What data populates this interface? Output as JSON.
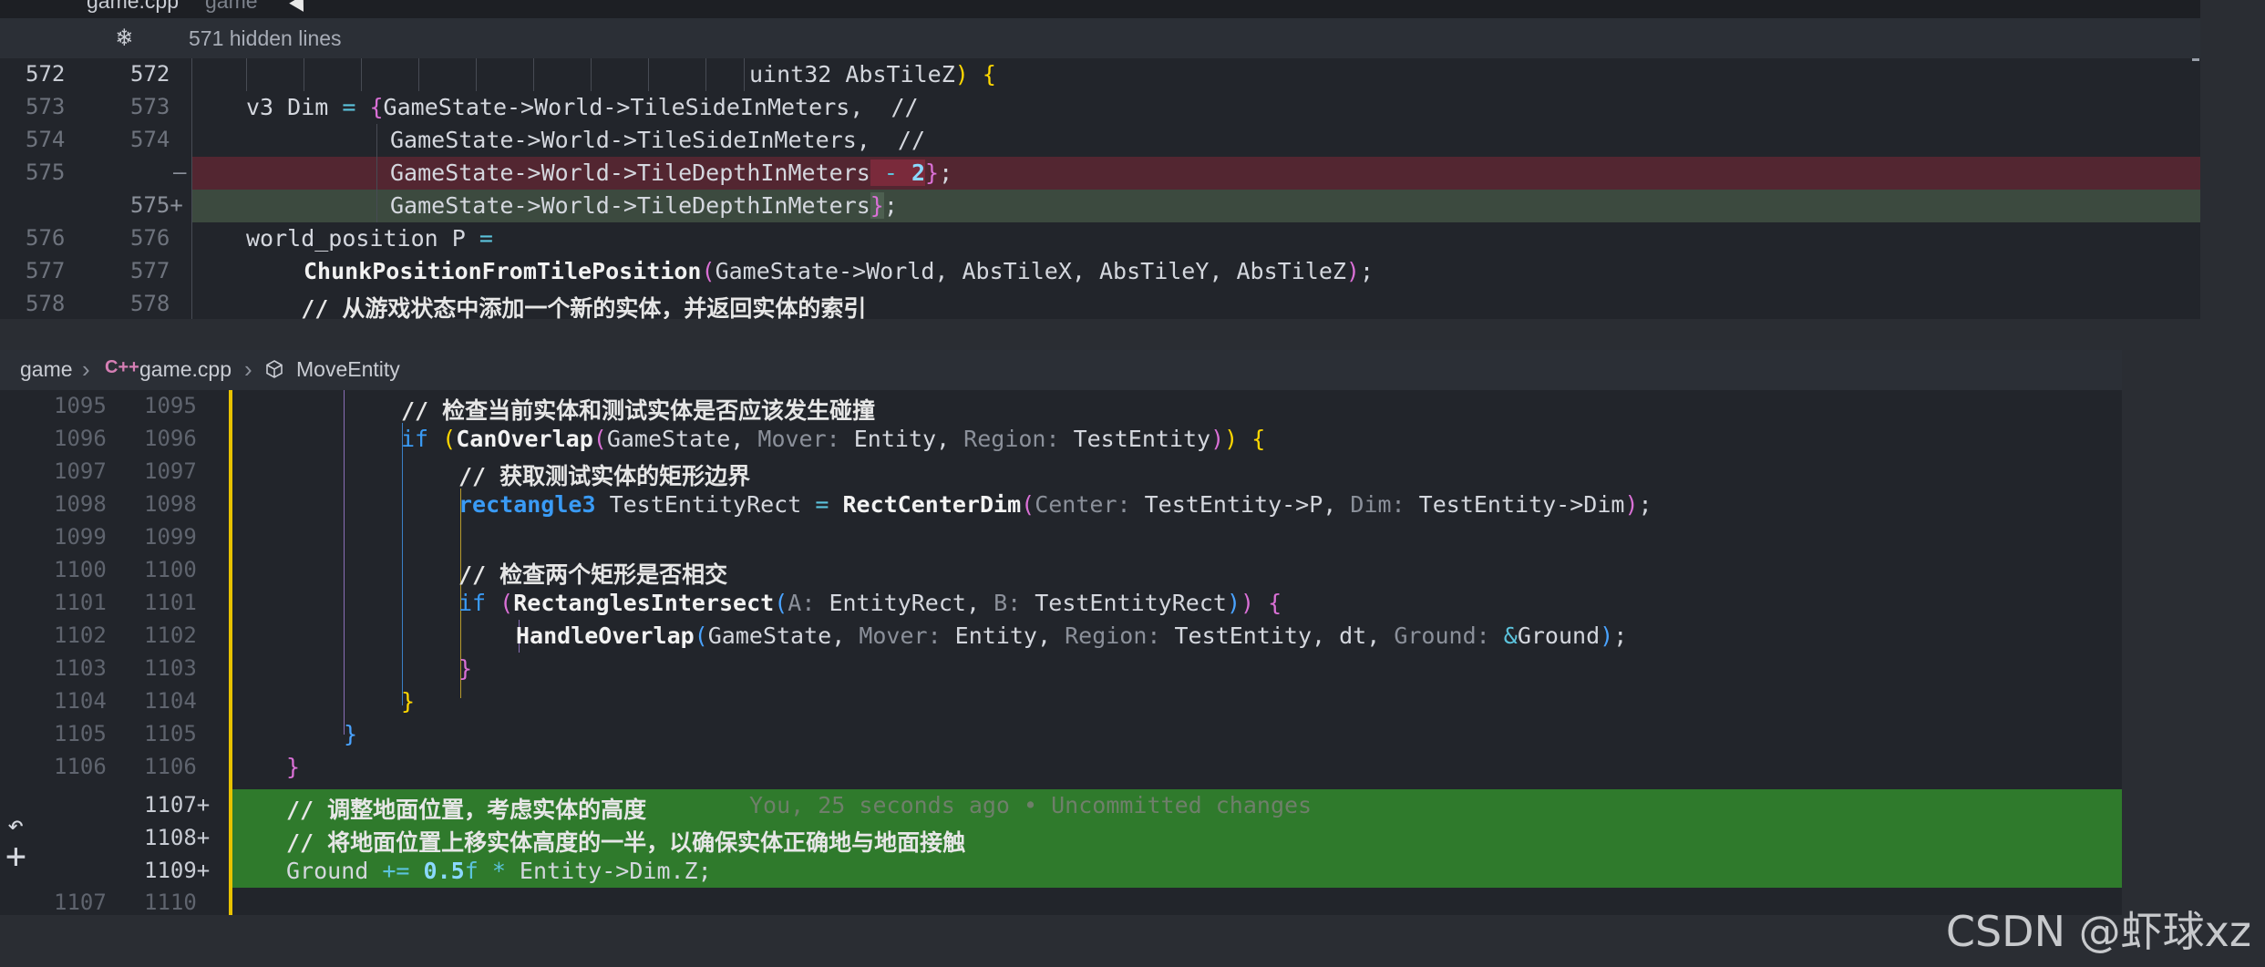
{
  "top_diff": {
    "tab_label": "game.cpp",
    "tab_sub": "game",
    "hidden_lines": "571 hidden lines",
    "rows": [
      {
        "old": "572",
        "new": "572",
        "text": "                                   uint32 AbsTileZ) {"
      },
      {
        "old": "573",
        "new": "573",
        "text": "    v3 Dim = {GameState->World->TileSideInMeters,  //"
      },
      {
        "old": "574",
        "new": "574",
        "text": "              GameState->World->TileSideInMeters,  //"
      },
      {
        "old": "575",
        "new": "—",
        "text": "              GameState->World->TileDepthInMeters - 2};"
      },
      {
        "old": "",
        "new": "575+",
        "text": "              GameState->World->TileDepthInMeters};"
      },
      {
        "old": "576",
        "new": "576",
        "text": "    world_position P ="
      },
      {
        "old": "577",
        "new": "577",
        "text": "        ChunkPositionFromTilePosition(GameState->World, AbsTileX, AbsTileY, AbsTileZ);"
      },
      {
        "old": "578",
        "new": "578",
        "text": "    // 从游戏状态中添加一个新的实体，并返回实体的索引"
      }
    ]
  },
  "breadcrumb": {
    "folder": "game",
    "file": "game.cpp",
    "cpp_icon": "C++",
    "symbol": "MoveEntity"
  },
  "editor": {
    "lines": [
      {
        "old": "1095",
        "new": "1095",
        "text": "// 检查当前实体和测试实体是否应该发生碰撞"
      },
      {
        "old": "1096",
        "new": "1096",
        "text": "if (CanOverlap(GameState, Mover: Entity, Region: TestEntity)) {"
      },
      {
        "old": "1097",
        "new": "1097",
        "text": "// 获取测试实体的矩形边界"
      },
      {
        "old": "1098",
        "new": "1098",
        "text": "rectangle3 TestEntityRect = RectCenterDim(Center: TestEntity->P, Dim: TestEntity->Dim);"
      },
      {
        "old": "1099",
        "new": "1099",
        "text": ""
      },
      {
        "old": "1100",
        "new": "1100",
        "text": "// 检查两个矩形是否相交"
      },
      {
        "old": "1101",
        "new": "1101",
        "text": "if (RectanglesIntersect(A: EntityRect, B: TestEntityRect)) {"
      },
      {
        "old": "1102",
        "new": "1102",
        "text": "HandleOverlap(GameState, Mover: Entity, Region: TestEntity, dt, Ground: &Ground);"
      },
      {
        "old": "1103",
        "new": "1103",
        "text": "}"
      },
      {
        "old": "1104",
        "new": "1104",
        "text": "}"
      },
      {
        "old": "1105",
        "new": "1105",
        "text": "}"
      },
      {
        "old": "1106",
        "new": "1106",
        "text": "}"
      },
      {
        "old": "",
        "new": "1107+",
        "text": "// 调整地面位置，考虑实体的高度"
      },
      {
        "old": "",
        "new": "1108+",
        "text": "// 将地面位置上移实体高度的一半，以确保实体正确地与地面接触"
      },
      {
        "old": "",
        "new": "1109+",
        "text": "Ground += 0.5f * Entity->Dim.Z;"
      },
      {
        "old": "1107",
        "new": "1110",
        "text": ""
      }
    ],
    "blame": "You, 25 seconds ago • Uncommitted changes",
    "hints": {
      "mover": "Mover:",
      "region": "Region:",
      "center": "Center:",
      "dim": "Dim:",
      "a": "A:",
      "b": "B:",
      "ground": "Ground:"
    }
  },
  "watermark": "CSDN @虾球xz",
  "colors": {
    "removed_bg": "#532631",
    "added_bg_top": "#3c4a3f",
    "added_bg_bottom": "#2f7a2c",
    "accent_yellow": "#e8c200",
    "keyword_blue": "#3a9bf5"
  },
  "icons": [
    "snowflake-icon",
    "cursor-icon",
    "cpp-file-icon",
    "method-cube-icon",
    "undo-icon",
    "plus-icon"
  ]
}
